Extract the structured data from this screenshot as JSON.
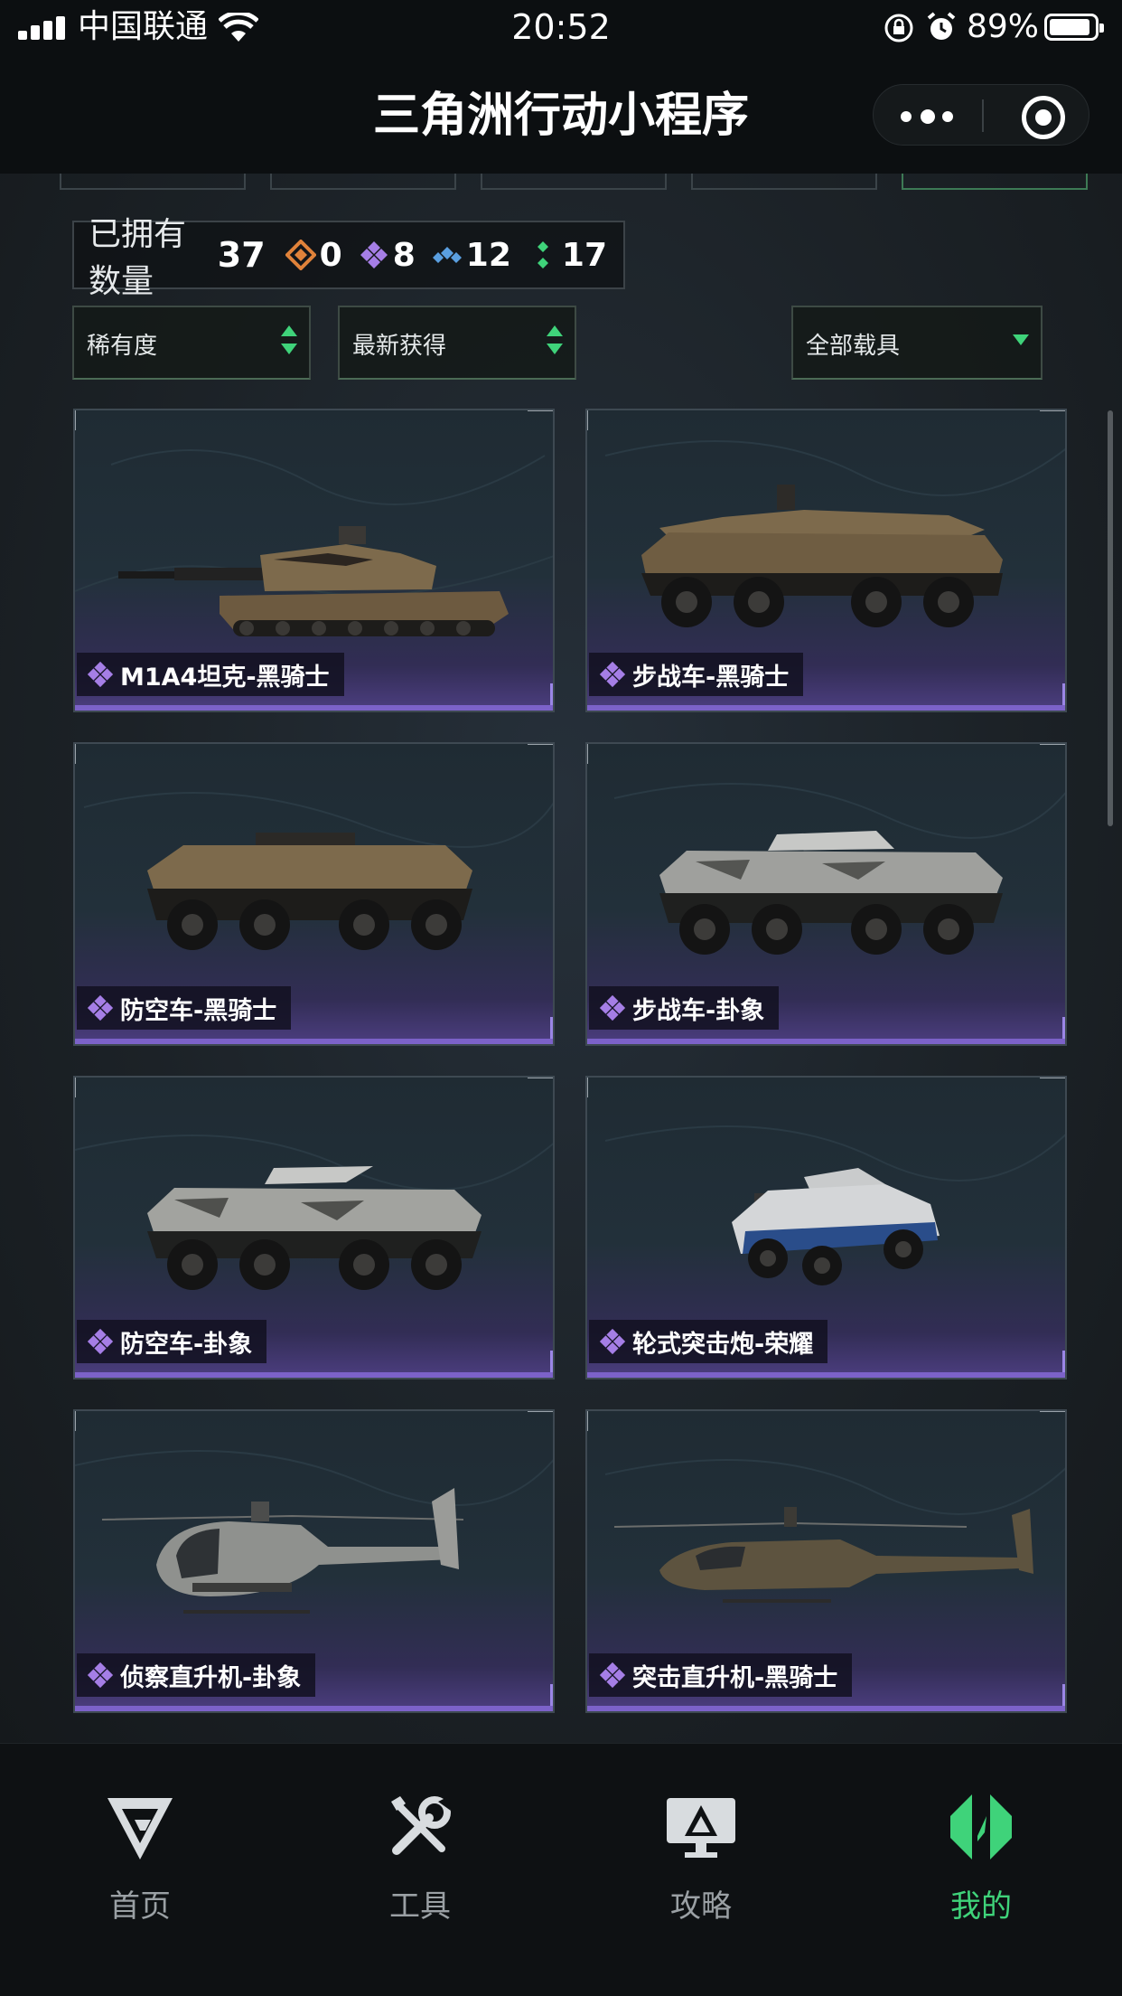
{
  "status_bar": {
    "carrier": "中国联通",
    "time": "20:52",
    "battery": "89%"
  },
  "nav": {
    "title": "三角洲行动小程序"
  },
  "owned": {
    "label": "已拥有数量",
    "total": "37",
    "rarities": [
      {
        "icon": "orange-diamond-icon",
        "color": "#e0823a",
        "count": "0"
      },
      {
        "icon": "purple-diamond-icon",
        "color": "#a57ee6",
        "count": "8"
      },
      {
        "icon": "blue-diamond-icon",
        "color": "#5a9fe0",
        "count": "12"
      },
      {
        "icon": "green-diamond-icon",
        "color": "#3fd37a",
        "count": "17"
      }
    ]
  },
  "filters": {
    "rarity": "稀有度",
    "recent": "最新获得",
    "vehicles": "全部载具"
  },
  "cards": [
    {
      "name": "M1A4坦克-黑骑士",
      "vehicle": "tank"
    },
    {
      "name": "步战车-黑骑士",
      "vehicle": "ifv"
    },
    {
      "name": "防空车-黑骑士",
      "vehicle": "aa"
    },
    {
      "name": "步战车-卦象",
      "vehicle": "ifv-camo"
    },
    {
      "name": "防空车-卦象",
      "vehicle": "aa-camo"
    },
    {
      "name": "轮式突击炮-荣耀",
      "vehicle": "assault-gun"
    },
    {
      "name": "侦察直升机-卦象",
      "vehicle": "scout-heli"
    },
    {
      "name": "突击直升机-黑骑士",
      "vehicle": "attack-heli"
    }
  ],
  "tabs": [
    {
      "label": "首页",
      "icon": "home-icon"
    },
    {
      "label": "工具",
      "icon": "tools-icon"
    },
    {
      "label": "攻略",
      "icon": "guide-icon"
    },
    {
      "label": "我的",
      "icon": "profile-icon",
      "active": true
    }
  ],
  "colors": {
    "accent_green": "#3fd37a",
    "epic_purple": "#7c62c9"
  }
}
